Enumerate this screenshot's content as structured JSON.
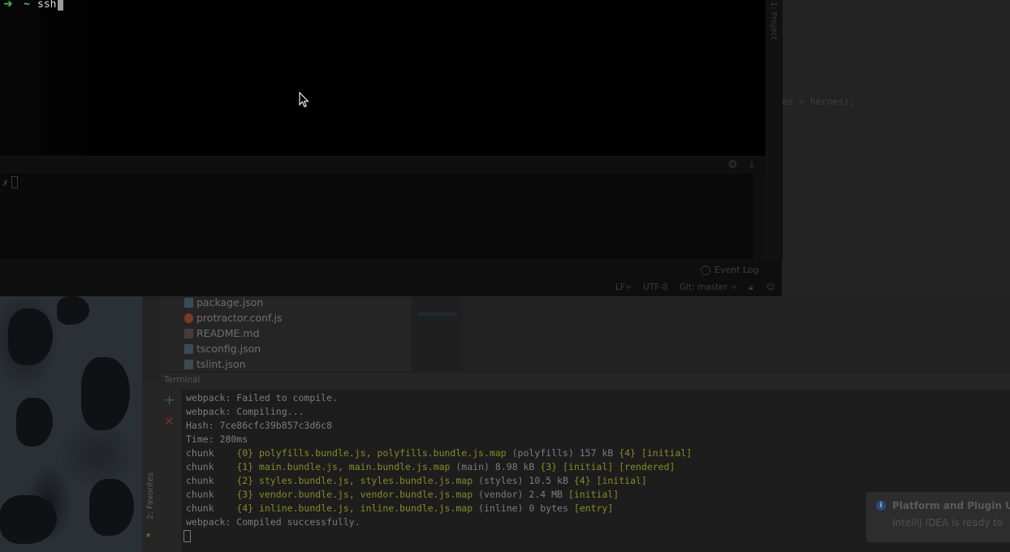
{
  "terminal": {
    "prompt_symbol": "➜",
    "prompt_dir": "~",
    "command": "ssh"
  },
  "inner_terminal": {
    "prompt_symbol": "✗"
  },
  "ide": {
    "side_panel_label": "1: Project",
    "editor_code_fragment": "es = heroes);",
    "event_log": "Event Log",
    "status": {
      "line_sep": "LF÷",
      "encoding": "UTF-8",
      "git": "Git: master ÷"
    },
    "project_files": [
      {
        "name": "package.json",
        "type": "json"
      },
      {
        "name": "protractor.conf.js",
        "type": "js"
      },
      {
        "name": "README.md",
        "type": "md"
      },
      {
        "name": "tsconfig.json",
        "type": "json"
      },
      {
        "name": "tslint.json",
        "type": "json"
      }
    ],
    "favorites_label": "2: Favorites",
    "terminal_tab_label": "Terminal",
    "terminal_output": {
      "l1": "webpack: Failed to compile.",
      "l2": "webpack: Compiling...",
      "l3": "Hash: 7ce86cfc39b857c3d6c8",
      "l4": "Time: 280ms",
      "chunks": [
        {
          "prefix": "chunk    ",
          "id": "{0}",
          "files": "polyfills.bundle.js, polyfills.bundle.js.map",
          "name": "(polyfills)",
          "size": "157 kB",
          "parent": "{4}",
          "flags": "[initial]"
        },
        {
          "prefix": "chunk    ",
          "id": "{1}",
          "files": "main.bundle.js, main.bundle.js.map",
          "name": "(main)",
          "size": "8.98 kB",
          "parent": "{3}",
          "flags": "[initial] [rendered]"
        },
        {
          "prefix": "chunk    ",
          "id": "{2}",
          "files": "styles.bundle.js, styles.bundle.js.map",
          "name": "(styles)",
          "size": "10.5 kB",
          "parent": "{4}",
          "flags": "[initial]"
        },
        {
          "prefix": "chunk    ",
          "id": "{3}",
          "files": "vendor.bundle.js, vendor.bundle.js.map",
          "name": "(vendor)",
          "size": "2.4 MB",
          "parent": "",
          "flags": "[initial]"
        },
        {
          "prefix": "chunk    ",
          "id": "{4}",
          "files": "inline.bundle.js, inline.bundle.js.map",
          "name": "(inline)",
          "size": "0 bytes",
          "parent": "",
          "flags": "[entry]"
        }
      ],
      "l_final": "webpack: Compiled successfully."
    }
  },
  "notification": {
    "title": "Platform and Plugin U",
    "body": "IntelliJ IDEA is ready to"
  },
  "colors": {
    "prompt_green": "#29c93d",
    "prompt_cyan": "#3ec6cf",
    "chunk_highlight": "#888a22"
  }
}
